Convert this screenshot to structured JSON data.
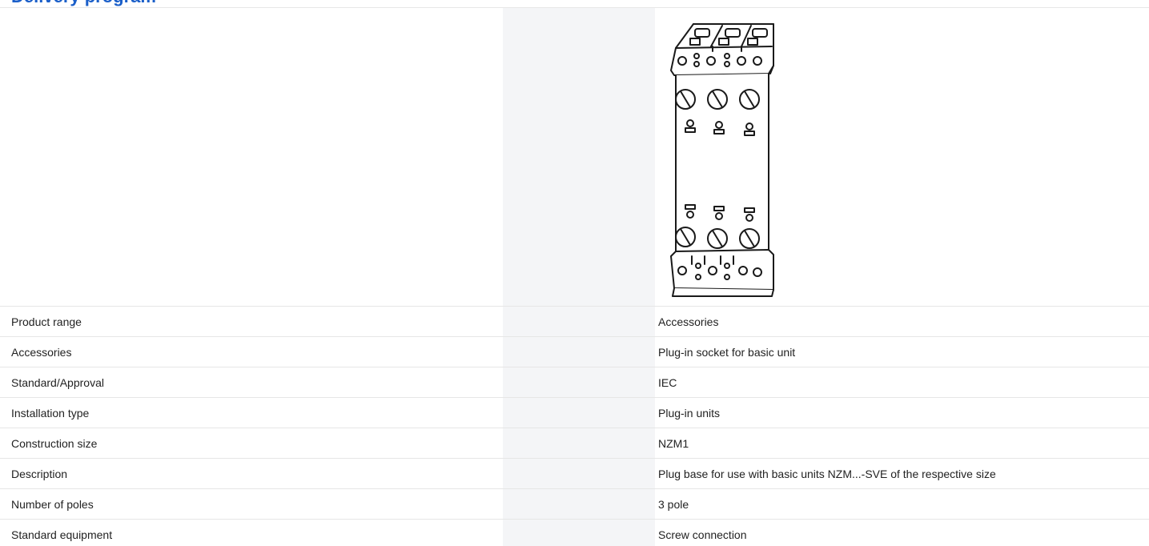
{
  "section": {
    "heading": "Delivery program"
  },
  "product_image": {
    "alt": "Plug-in socket for basic unit"
  },
  "specs": [
    {
      "label": "Product range",
      "value": "Accessories"
    },
    {
      "label": "Accessories",
      "value": "Plug-in socket for basic unit"
    },
    {
      "label": "Standard/Approval",
      "value": "IEC"
    },
    {
      "label": "Installation type",
      "value": "Plug-in units"
    },
    {
      "label": "Construction size",
      "value": "NZM1"
    },
    {
      "label": "Description",
      "value": "Plug base for use with basic units NZM...-SVE of the respective size"
    },
    {
      "label": "Number of poles",
      "value": "3 pole"
    },
    {
      "label": "Standard equipment",
      "value": "Screw connection"
    }
  ]
}
